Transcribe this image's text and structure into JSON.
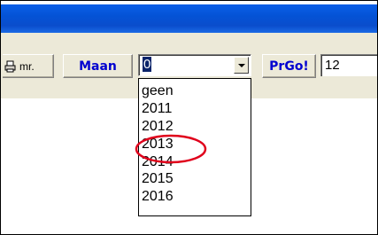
{
  "toolbar": {
    "print_label": "mr.",
    "maan_label": "Maan",
    "prgo_label": "PrGo!",
    "number_value": "12"
  },
  "year_select": {
    "selected_value": "0",
    "options": [
      "geen",
      "2011",
      "2012",
      "2013",
      "2014",
      "2015",
      "2016"
    ],
    "highlighted_option": "2013"
  },
  "colors": {
    "titlebar_blue": "#0453d6",
    "button_text_blue": "#0000d0",
    "selection_navy": "#0a246a",
    "highlight_circle_red": "#e0001b"
  },
  "icons": [
    "printer-icon",
    "dropdown-arrow-icon"
  ]
}
